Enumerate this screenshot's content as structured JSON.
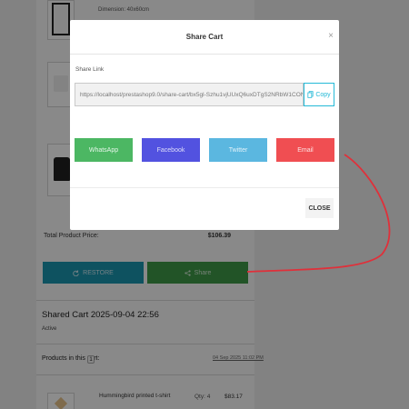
{
  "background": {
    "product_dimension": "Dimension: 40x60cm",
    "total_label": "Total Product Price:",
    "total_value": "$106.39",
    "restore_label": "RESTORE",
    "share_label": "Share",
    "shared_cart_title": "Shared Cart 2025-09-04 22:56",
    "shared_cart_status": "Active",
    "products_label": "Products in this cart:",
    "products_count": "1",
    "products_date": "04 Sep 2025 11:02 PM",
    "line_item": {
      "name": "Hummingbird printed t-shirt",
      "qty": "Qty: 4",
      "price": "$83.17"
    }
  },
  "modal": {
    "title": "Share Cart",
    "close_icon": "×",
    "share_link_label": "Share Link",
    "share_link_value": "https://localhost/prestashop9.0/share-cart/bx5gl-Szhu1vjUUxQ6uxDTgS2NRbW1CONS",
    "copy_label": "Copy",
    "social_buttons": {
      "whatsapp": "WhatsApp",
      "facebook": "Facebook",
      "twitter": "Twitter",
      "email": "Email"
    },
    "close_label": "CLOSE"
  },
  "icons": {
    "restore": "refresh-icon",
    "share": "share-icon",
    "copy": "copy-icon",
    "close": "close-icon"
  },
  "colors": {
    "restore": "#1a95b0",
    "share": "#3f9a48",
    "whatsapp": "#4cb763",
    "facebook": "#5252e0",
    "twitter": "#5bb7e0",
    "email": "#f04e52",
    "copy_accent": "#24b9d7",
    "annotation": "#e0303a"
  }
}
